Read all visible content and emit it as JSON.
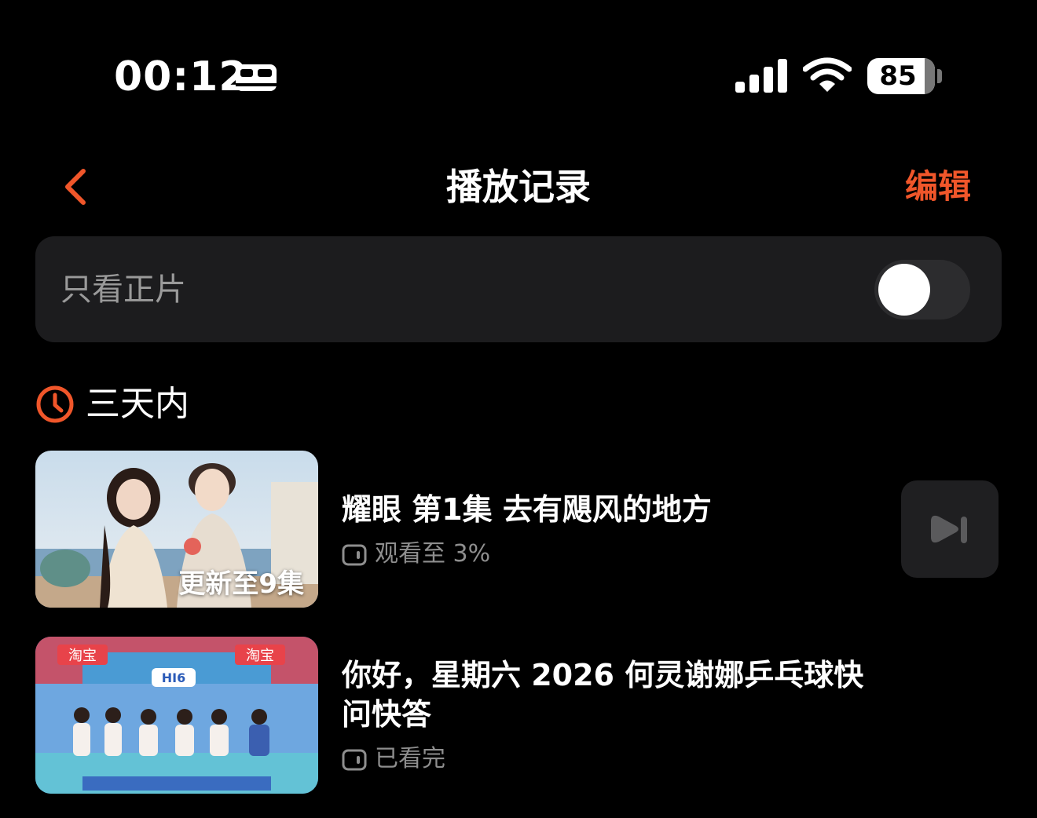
{
  "status_bar": {
    "time": "00:12",
    "battery_level": "85",
    "icons": [
      "sleep-focus-icon",
      "cellular-signal-icon",
      "wifi-icon",
      "battery-icon"
    ]
  },
  "nav": {
    "back_icon": "chevron-left-icon",
    "title": "播放记录",
    "edit_label": "编辑"
  },
  "filter": {
    "label": "只看正片",
    "enabled": false
  },
  "section": {
    "icon": "clock-icon",
    "title": "三天内"
  },
  "history": [
    {
      "title": "耀眼 第1集 去有飓风的地方",
      "badge": "更新至9集",
      "progress_text": "观看至 3%",
      "progress": 0.03,
      "action_icon": "play-next-icon"
    },
    {
      "title": "你好，星期六 2026 何灵谢娜乒乓球快问快答",
      "badge": "",
      "progress_text": "已看完",
      "progress": 1.0
    }
  ],
  "thumbnail_logos": [
    "淘宝",
    "淘宝",
    "HI6"
  ],
  "colors": {
    "accent": "#f0562a",
    "background": "#000000",
    "card": "#1c1c1e",
    "secondary_text": "#8e8e8e"
  }
}
